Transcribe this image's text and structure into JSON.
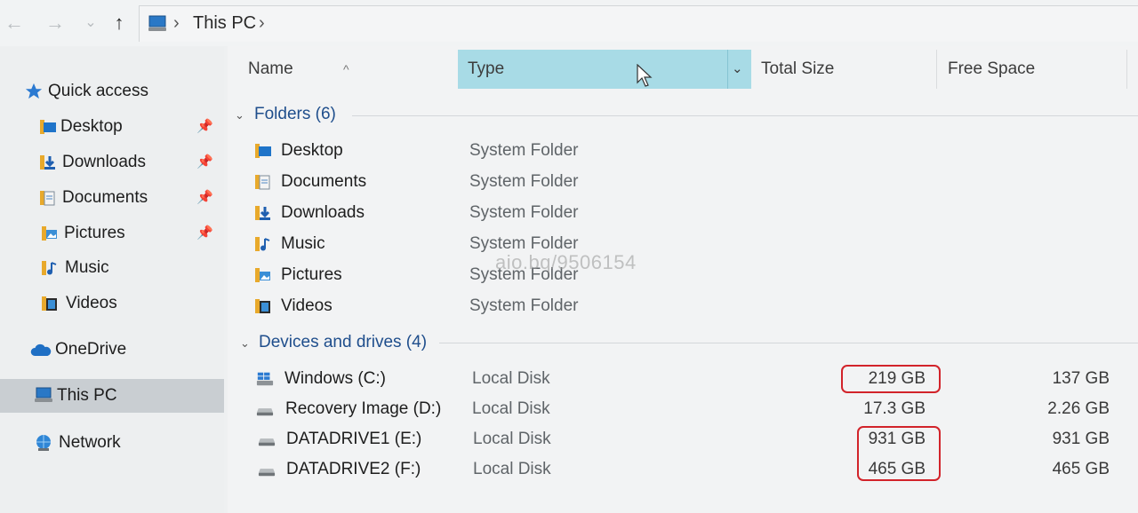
{
  "address_bar": {
    "back_glyph": "←",
    "forward_glyph": "→",
    "recent_glyph": "⌄",
    "up_glyph": "↑",
    "separator": "›",
    "location": "This PC"
  },
  "sidebar": {
    "quick_access": "Quick access",
    "pin_glyph": "📌",
    "items": [
      {
        "label": "Desktop",
        "pinned": true
      },
      {
        "label": "Downloads",
        "pinned": true
      },
      {
        "label": "Documents",
        "pinned": true
      },
      {
        "label": "Pictures",
        "pinned": true
      },
      {
        "label": "Music",
        "pinned": false
      },
      {
        "label": "Videos",
        "pinned": false
      }
    ],
    "onedrive": "OneDrive",
    "this_pc": "This PC",
    "network": "Network"
  },
  "columns": {
    "name": "Name",
    "type": "Type",
    "total_size": "Total Size",
    "free_space": "Free Space",
    "dropdown_glyph": "⌄",
    "sort_glyph": "^"
  },
  "folders": {
    "header": "Folders (6)",
    "collapse_glyph": "⌄",
    "items": [
      {
        "name": "Desktop",
        "type": "System Folder"
      },
      {
        "name": "Documents",
        "type": "System Folder"
      },
      {
        "name": "Downloads",
        "type": "System Folder"
      },
      {
        "name": "Music",
        "type": "System Folder"
      },
      {
        "name": "Pictures",
        "type": "System Folder"
      },
      {
        "name": "Videos",
        "type": "System Folder"
      }
    ]
  },
  "drives": {
    "header": "Devices and drives (4)",
    "collapse_glyph": "⌄",
    "items": [
      {
        "name": "Windows (C:)",
        "type": "Local Disk",
        "total": "219 GB",
        "free": "137 GB"
      },
      {
        "name": "Recovery Image (D:)",
        "type": "Local Disk",
        "total": "17.3 GB",
        "free": "2.26 GB"
      },
      {
        "name": "DATADRIVE1 (E:)",
        "type": "Local Disk",
        "total": "931 GB",
        "free": "931 GB"
      },
      {
        "name": "DATADRIVE2 (F:)",
        "type": "Local Disk",
        "total": "465 GB",
        "free": "465 GB"
      }
    ]
  },
  "watermark": "aio.bq/9506154",
  "colors": {
    "accent": "#1f4e8c",
    "selected_column": "#a8dbe6",
    "highlight": "#d2232a"
  }
}
